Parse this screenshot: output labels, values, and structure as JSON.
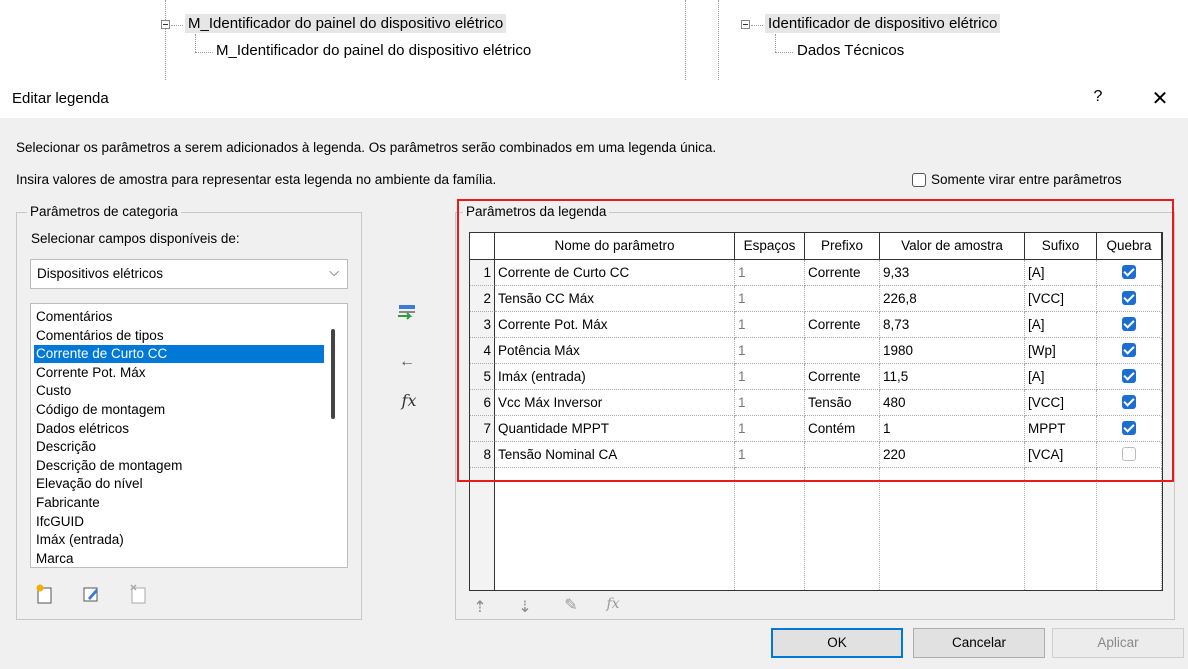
{
  "tree": {
    "left_parent": "M_Identificador do painel do dispositivo elétrico",
    "left_child": "M_Identificador do painel do dispositivo elétrico",
    "right_parent": "Identificador de dispositivo elétrico",
    "right_child": "Dados Técnicos"
  },
  "dialog": {
    "title": "Editar legenda",
    "help": "?",
    "close": "✕",
    "desc1": "Selecionar os parâmetros a serem adicionados à legenda. Os parâmetros serão combinados em uma legenda única.",
    "desc2": "Insira valores de amostra para representar esta legenda no ambiente da família.",
    "wrap_only_label": "Somente virar entre parâmetros"
  },
  "category": {
    "group_title": "Parâmetros de categoria",
    "select_label": "Selecionar campos disponíveis de:",
    "select_value": "Dispositivos elétricos",
    "items": [
      "Comentários",
      "Comentários de tipos",
      "Corrente de Curto CC",
      "Corrente Pot. Máx",
      "Custo",
      "Código de montagem",
      "Dados elétricos",
      "Descrição",
      "Descrição de montagem",
      "Elevação do nível",
      "Fabricante",
      "IfcGUID",
      "Imáx (entrada)",
      "Marca"
    ],
    "selected_index": 2
  },
  "icons": {
    "add": "add-parameter-icon",
    "remove": "remove-parameter-icon",
    "fx": "fx",
    "fx_icon": "formula-icon"
  },
  "legend_params": {
    "group_title": "Parâmetros da legenda",
    "columns": [
      "Nome do parâmetro",
      "Espaços",
      "Prefixo",
      "Valor de amostra",
      "Sufixo",
      "Quebra"
    ],
    "rows": [
      {
        "n": "1",
        "name": "Corrente de Curto CC",
        "spaces": "1",
        "prefix": "Corrente",
        "sample": "9,33",
        "suffix": "[A]",
        "wrap": true
      },
      {
        "n": "2",
        "name": "Tensão CC Máx",
        "spaces": "1",
        "prefix": "",
        "sample": "226,8",
        "suffix": "[VCC]",
        "wrap": true
      },
      {
        "n": "3",
        "name": "Corrente Pot. Máx",
        "spaces": "1",
        "prefix": "Corrente",
        "sample": "8,73",
        "suffix": "[A]",
        "wrap": true
      },
      {
        "n": "4",
        "name": "Potência Máx",
        "spaces": "1",
        "prefix": "",
        "sample": "1980",
        "suffix": "[Wp]",
        "wrap": true
      },
      {
        "n": "5",
        "name": "Imáx (entrada)",
        "spaces": "1",
        "prefix": "Corrente",
        "sample": "11,5",
        "suffix": "[A]",
        "wrap": true
      },
      {
        "n": "6",
        "name": "Vcc Máx Inversor",
        "spaces": "1",
        "prefix": "Tensão",
        "sample": "480",
        "suffix": "[VCC]",
        "wrap": true
      },
      {
        "n": "7",
        "name": "Quantidade MPPT",
        "spaces": "1",
        "prefix": "Contém",
        "sample": "1",
        "suffix": "MPPT",
        "wrap": true
      },
      {
        "n": "8",
        "name": "Tensão Nominal CA",
        "spaces": "1",
        "prefix": "",
        "sample": "220",
        "suffix": "[VCA]",
        "wrap": false
      }
    ]
  },
  "buttons": {
    "ok": "OK",
    "cancel": "Cancelar",
    "apply": "Aplicar"
  },
  "colors": {
    "selection": "#0078d7",
    "highlight_box": "#e81a1a",
    "checkbox_on": "#1c6fd1"
  }
}
